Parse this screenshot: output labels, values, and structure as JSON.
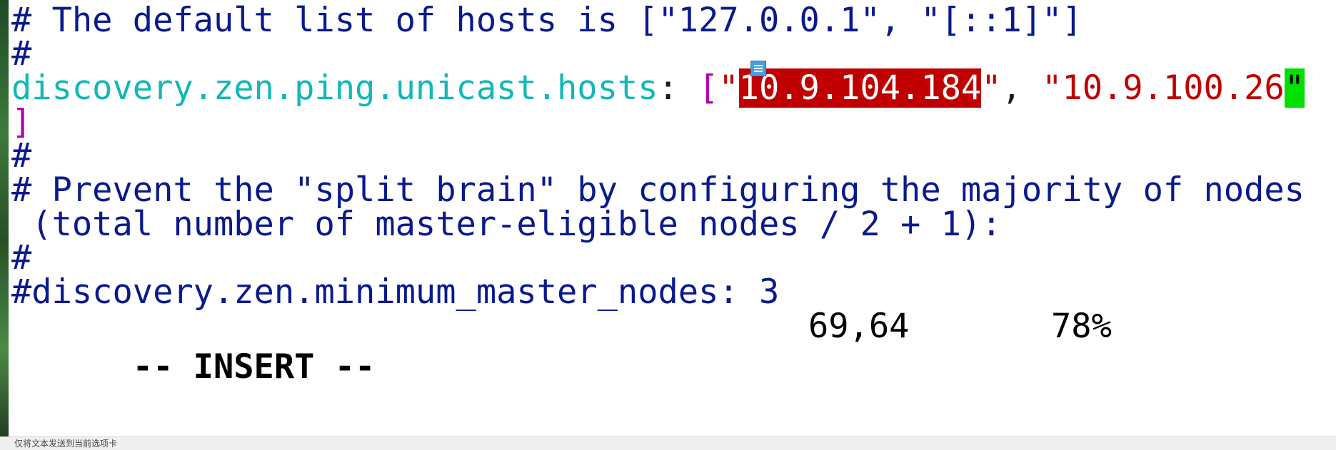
{
  "editor": {
    "lines": [
      {
        "text": "# The default list of hosts is [\"127.0.0.1\", \"[::1]\"]"
      },
      {
        "text": "#"
      },
      {
        "key": "discovery.zen.ping.unicast.hosts",
        "colon": ": ",
        "bracket_open": "[",
        "quote1": "\"",
        "ip1": "10.9.104.184",
        "quote2": "\"",
        "sep": ", ",
        "ip2": "\"10.9.100.26",
        "cursor_char": "\""
      },
      {
        "text": "]"
      },
      {
        "text": "#"
      },
      {
        "text": "# Prevent the \"split brain\" by configuring the majority of nodes"
      },
      {
        "text": " (total number of master-eligible nodes / 2 + 1):"
      },
      {
        "text": "#"
      },
      {
        "text": "#discovery.zen.minimum_master_nodes: 3"
      }
    ]
  },
  "statusline": {
    "mode": "-- INSERT --",
    "position": "69,64",
    "percent": "78%"
  },
  "footer": {
    "text": "仅将文本发送到当前选项卡"
  },
  "colors": {
    "comment": "#0a1a8c",
    "key": "#13b7b7",
    "bracket": "#b400b4",
    "string": "#c00000",
    "selection_bg": "#c00000",
    "cursor_bg": "#00e000"
  },
  "icons": {
    "note": "note-icon"
  }
}
